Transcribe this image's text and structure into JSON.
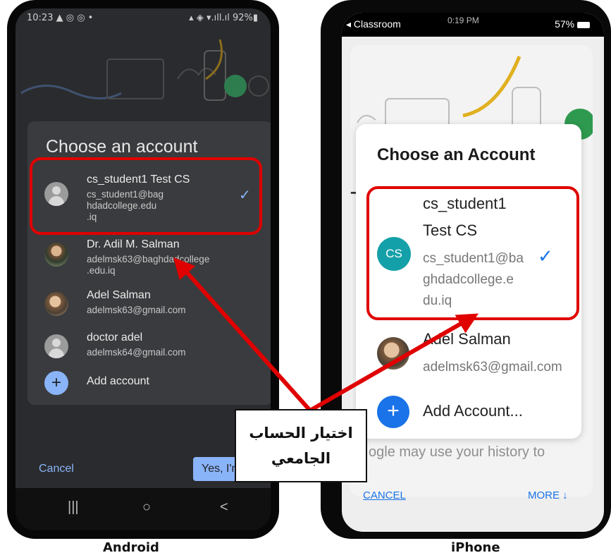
{
  "android": {
    "status_time": "10:23 ▲ ◎ ◎ •",
    "status_right": "▴ ◈ ▾.ıll.ıl 92%▮",
    "dialog_title": "Choose an account",
    "accounts": [
      {
        "name": "cs_student1 Test CS",
        "email_lines": [
          "cs_student1@bag",
          "hdadcollege.edu",
          ".iq"
        ],
        "selected": true
      },
      {
        "name": "Dr. Adil M. Salman",
        "email_lines": [
          "adelmsk63@baghdadcollege",
          ".edu.iq"
        ]
      },
      {
        "name": "Adel Salman",
        "email_lines": [
          "adelmsk63@gmail.com"
        ]
      },
      {
        "name": "doctor adel",
        "email_lines": [
          "adelmsk64@gmail.com"
        ]
      }
    ],
    "add_account": "Add account",
    "cancel": "Cancel",
    "yes": "Yes, I'm",
    "nav": [
      "|||",
      "○",
      "<"
    ],
    "check": "✓",
    "plus": "+"
  },
  "iphone": {
    "status_left": "◂ Classroom",
    "status_center": "0:19 PM",
    "status_right": "57%",
    "dialog_title": "Choose an Account",
    "account_name_lines": [
      "cs_student1",
      "Test CS"
    ],
    "account_email_lines": [
      "cs_student1@ba",
      "ghdadcollege.e",
      "du.iq"
    ],
    "avatar_initials": "CS",
    "second_name": "Adel Salman",
    "second_email": "adelmsk63@gmail.com",
    "add_account": "Add Account...",
    "bg_text_1": "Te",
    "bg_text_2": "ogle may use your history to",
    "cancel": "CANCEL",
    "more": "MORE ↓",
    "check": "✓",
    "plus": "+"
  },
  "callout": {
    "line1": "اختيار الحساب",
    "line2": "الجامعي"
  },
  "captions": {
    "left": "Android",
    "right": "iPhone"
  },
  "colors": {
    "highlight": "#e00000",
    "android_accent": "#8ab4f8",
    "ios_accent": "#1a73e8",
    "cs_avatar": "#14a0a8"
  }
}
